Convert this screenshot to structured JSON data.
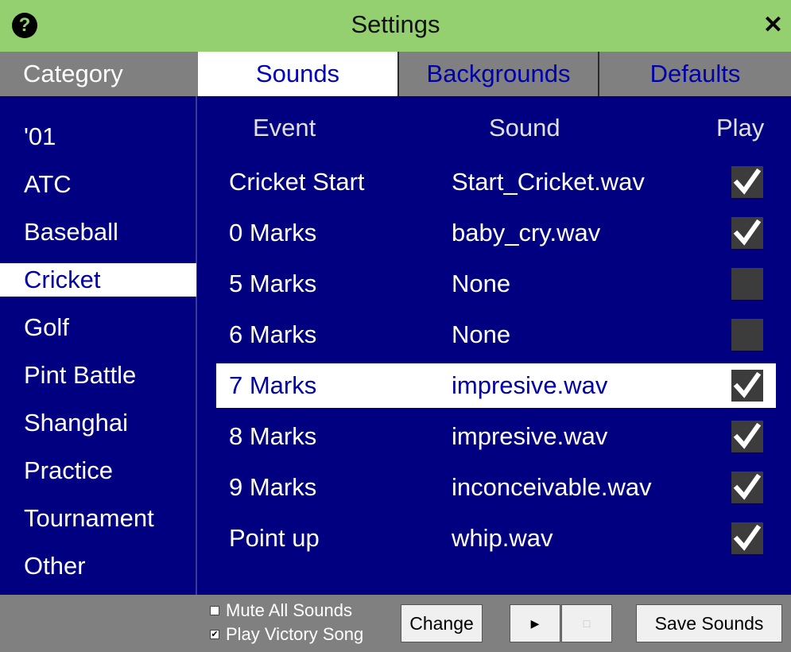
{
  "window": {
    "title": "Settings",
    "help_icon": "?",
    "close_icon": "✕"
  },
  "tabs": {
    "category_label": "Category",
    "items": [
      {
        "label": "Sounds",
        "active": true
      },
      {
        "label": "Backgrounds",
        "active": false
      },
      {
        "label": "Defaults",
        "active": false
      }
    ]
  },
  "sidebar": {
    "selected": "Cricket",
    "items": [
      "'01",
      "ATC",
      "Baseball",
      "Cricket",
      "Golf",
      "Pint Battle",
      "Shanghai",
      "Practice",
      "Tournament",
      "Other"
    ]
  },
  "table": {
    "headers": {
      "event": "Event",
      "sound": "Sound",
      "play": "Play"
    },
    "rows": [
      {
        "event": "Cricket Start",
        "sound": "Start_Cricket.wav",
        "play": true
      },
      {
        "event": "0 Marks",
        "sound": "baby_cry.wav",
        "play": true
      },
      {
        "event": "5 Marks",
        "sound": "None",
        "play": false
      },
      {
        "event": "6 Marks",
        "sound": "None",
        "play": false
      },
      {
        "event": "7 Marks",
        "sound": "impresive.wav",
        "play": true,
        "selected": true
      },
      {
        "event": "8 Marks",
        "sound": "impresive.wav",
        "play": true
      },
      {
        "event": "9 Marks",
        "sound": "inconceivable.wav",
        "play": true
      },
      {
        "event": "Point up",
        "sound": "whip.wav",
        "play": true
      }
    ]
  },
  "options": {
    "mute_all": {
      "label": "Mute All Sounds",
      "checked": false
    },
    "play_victory": {
      "label": "Play Victory Song",
      "checked": true
    }
  },
  "buttons": {
    "change": "Change",
    "play_icon": "▶",
    "stop_icon": "□",
    "save": "Save Sounds"
  },
  "colors": {
    "title_bar": "#95d070",
    "background": "#000080",
    "header_gray": "#808080",
    "accent_text": "#0000a8"
  }
}
